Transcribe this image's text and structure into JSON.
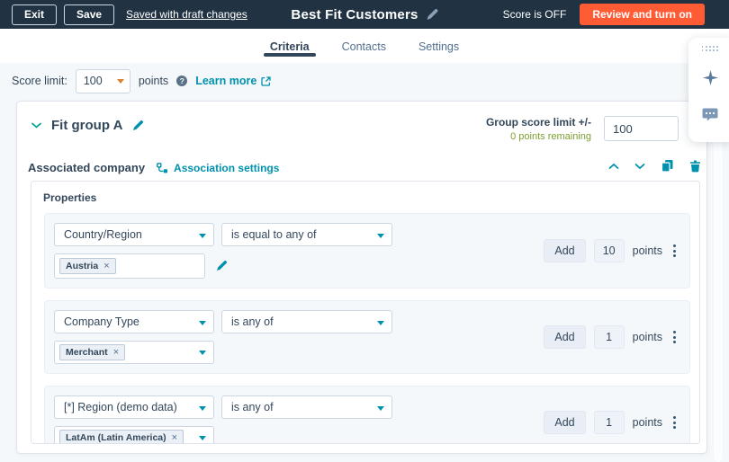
{
  "topbar": {
    "exit": "Exit",
    "save": "Save",
    "draft_status": "Saved with draft changes",
    "title": "Best Fit Customers",
    "score_status": "Score is OFF",
    "review_button": "Review and turn on"
  },
  "tabs": {
    "criteria": "Criteria",
    "contacts": "Contacts",
    "settings": "Settings"
  },
  "score_limit": {
    "label": "Score limit:",
    "value": "100",
    "points": "points",
    "learn_more": "Learn more"
  },
  "group": {
    "name": "Fit group A",
    "limit_label": "Group score limit +/-",
    "points_remaining": "0 points remaining",
    "limit_value": "100",
    "association_label": "Associated company",
    "association_settings": "Association settings",
    "properties_label": "Properties",
    "rows": [
      {
        "property": "Country/Region",
        "operator": "is equal to any of",
        "value": "Austria",
        "add": "Add",
        "points_value": "10",
        "points": "points"
      },
      {
        "property": "Company Type",
        "operator": "is any of",
        "value": "Merchant",
        "add": "Add",
        "points_value": "1",
        "points": "points"
      },
      {
        "property": "[*] Region (demo data)",
        "operator": "is any of",
        "value": "LatAm (Latin America)",
        "add": "Add",
        "points_value": "1",
        "points": "points"
      }
    ]
  },
  "icons": {
    "remove_tag": "×",
    "info": "?"
  },
  "colors": {
    "topbar_bg": "#213343",
    "accent_orange": "#ff5c35",
    "link_teal": "#0091ae",
    "text_dark": "#33475b",
    "text_muted": "#516f90",
    "remaining_green": "#7aa030",
    "page_bg": "#f5f8fa",
    "input_border": "#cbd6e2"
  }
}
